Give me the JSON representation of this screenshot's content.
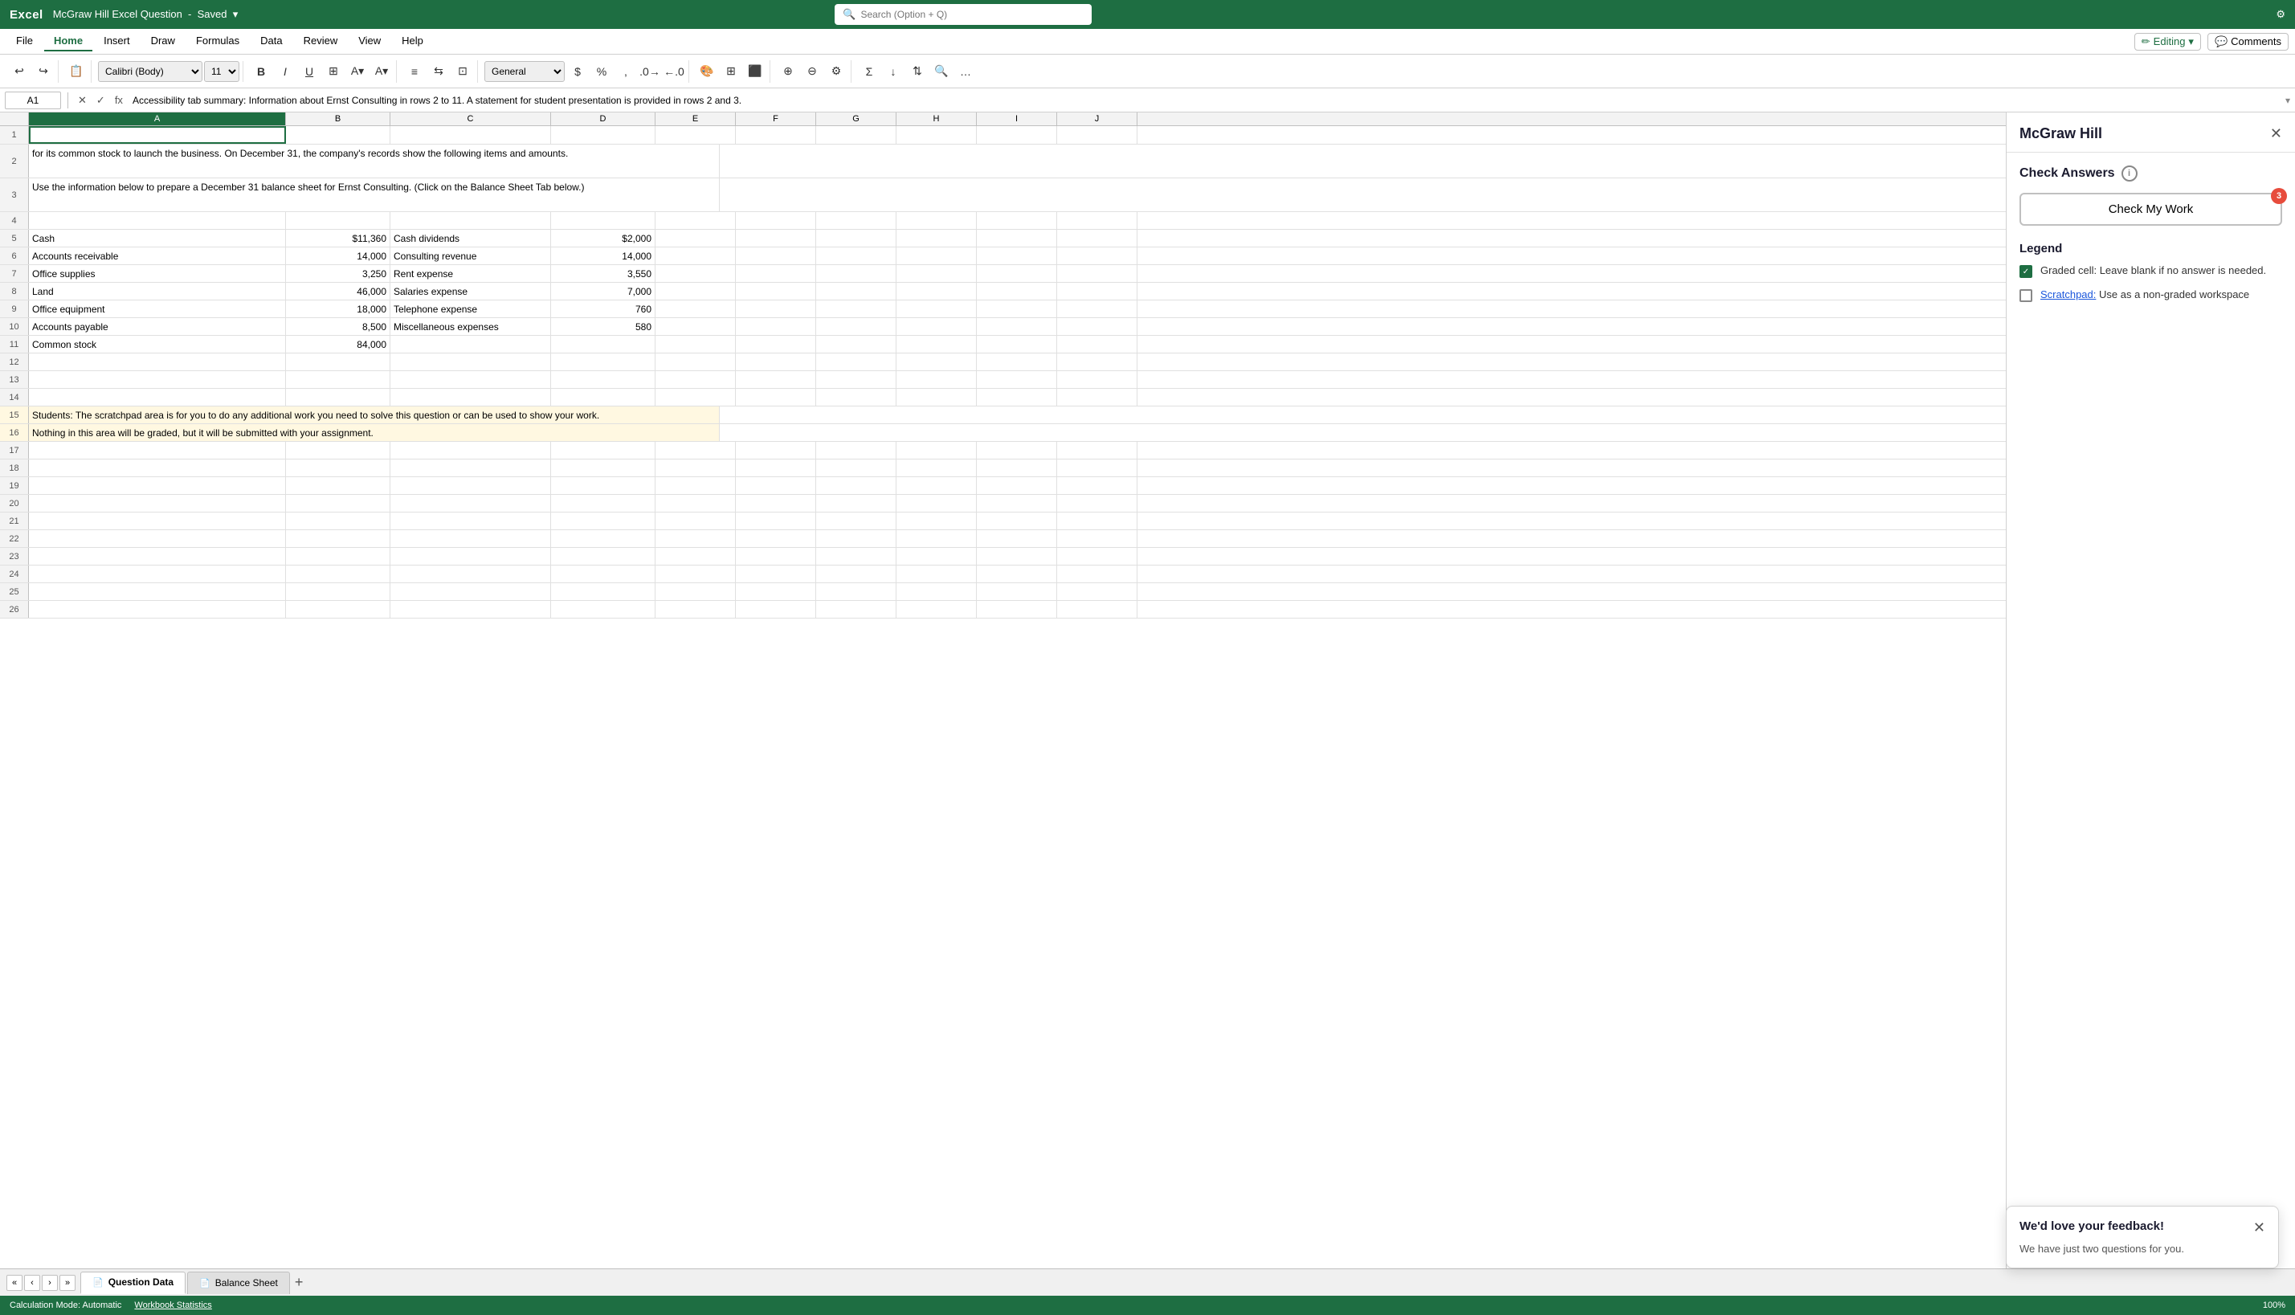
{
  "titleBar": {
    "appName": "Excel",
    "docName": "McGraw Hill Excel Question",
    "savedStatus": "Saved",
    "searchPlaceholder": "Search (Option + Q)",
    "settingsIcon": "⚙"
  },
  "ribbonTabs": {
    "tabs": [
      "File",
      "Home",
      "Insert",
      "Draw",
      "Formulas",
      "Data",
      "Review",
      "View",
      "Help"
    ],
    "activeTab": "Home",
    "editingLabel": "✏ Editing",
    "commentsLabel": "💬 Comments"
  },
  "toolbar": {
    "undoIcon": "↩",
    "redoIcon": "↪",
    "fontName": "Calibri (Body)",
    "fontSize": "11",
    "boldLabel": "B",
    "formatNumber": "General"
  },
  "formulaBar": {
    "cellRef": "A1",
    "formula": "Accessibility tab summary: Information about Ernst Consulting in rows 2 to 11. A statement for student presentation is provided in rows 2 and 3."
  },
  "columns": [
    "A",
    "B",
    "C",
    "D",
    "E",
    "F",
    "G",
    "H",
    "I",
    "J"
  ],
  "rows": [
    {
      "num": 1,
      "cells": [
        "",
        "",
        "",
        "",
        "",
        "",
        "",
        "",
        "",
        ""
      ]
    },
    {
      "num": 2,
      "cells": [
        "for its common stock to launch the business. On December 31, the company's records show the following items and amounts.",
        "",
        "",
        "",
        "",
        "",
        "",
        "",
        "",
        ""
      ],
      "merged": true
    },
    {
      "num": 3,
      "cells": [
        "Use the information below to prepare a December 31 balance sheet for Ernst Consulting. (Click on the Balance Sheet Tab below.)",
        "",
        "",
        "",
        "",
        "",
        "",
        "",
        "",
        ""
      ],
      "merged": true
    },
    {
      "num": 4,
      "cells": [
        "",
        "",
        "",
        "",
        "",
        "",
        "",
        "",
        "",
        ""
      ]
    },
    {
      "num": 5,
      "cells": [
        "Cash",
        "$11,360",
        "Cash dividends",
        "$2,000",
        "",
        "",
        "",
        "",
        "",
        ""
      ]
    },
    {
      "num": 6,
      "cells": [
        "Accounts receivable",
        "14,000",
        "Consulting revenue",
        "14,000",
        "",
        "",
        "",
        "",
        "",
        ""
      ]
    },
    {
      "num": 7,
      "cells": [
        "Office supplies",
        "3,250",
        "Rent expense",
        "3,550",
        "",
        "",
        "",
        "",
        "",
        ""
      ]
    },
    {
      "num": 8,
      "cells": [
        "Land",
        "46,000",
        "Salaries expense",
        "7,000",
        "",
        "",
        "",
        "",
        "",
        ""
      ]
    },
    {
      "num": 9,
      "cells": [
        "Office equipment",
        "18,000",
        "Telephone expense",
        "760",
        "",
        "",
        "",
        "",
        "",
        ""
      ]
    },
    {
      "num": 10,
      "cells": [
        "Accounts payable",
        "8,500",
        "Miscellaneous expenses",
        "580",
        "",
        "",
        "",
        "",
        "",
        ""
      ]
    },
    {
      "num": 11,
      "cells": [
        "Common stock",
        "84,000",
        "",
        "",
        "",
        "",
        "",
        "",
        "",
        ""
      ]
    },
    {
      "num": 12,
      "cells": [
        "",
        "",
        "",
        "",
        "",
        "",
        "",
        "",
        "",
        ""
      ]
    },
    {
      "num": 13,
      "cells": [
        "",
        "",
        "",
        "",
        "",
        "",
        "",
        "",
        "",
        ""
      ]
    },
    {
      "num": 14,
      "cells": [
        "",
        "",
        "",
        "",
        "",
        "",
        "",
        "",
        "",
        ""
      ]
    },
    {
      "num": 15,
      "cells": [
        "Students: The scratchpad area is for you to do any additional work you need to solve this question or can be used to show your work.",
        "",
        "",
        "",
        "",
        "",
        "",
        "",
        "",
        ""
      ],
      "scratchpad": true,
      "merged": true
    },
    {
      "num": 16,
      "cells": [
        "Nothing in this area will be graded, but it will be submitted with your assignment.",
        "",
        "",
        "",
        "",
        "",
        "",
        "",
        "",
        ""
      ],
      "scratchpad": true,
      "merged": true
    },
    {
      "num": 17,
      "cells": [
        "",
        "",
        "",
        "",
        "",
        "",
        "",
        "",
        "",
        ""
      ]
    },
    {
      "num": 18,
      "cells": [
        "",
        "",
        "",
        "",
        "",
        "",
        "",
        "",
        "",
        ""
      ]
    },
    {
      "num": 19,
      "cells": [
        "",
        "",
        "",
        "",
        "",
        "",
        "",
        "",
        "",
        ""
      ]
    },
    {
      "num": 20,
      "cells": [
        "",
        "",
        "",
        "",
        "",
        "",
        "",
        "",
        "",
        ""
      ]
    },
    {
      "num": 21,
      "cells": [
        "",
        "",
        "",
        "",
        "",
        "",
        "",
        "",
        "",
        ""
      ]
    },
    {
      "num": 22,
      "cells": [
        "",
        "",
        "",
        "",
        "",
        "",
        "",
        "",
        "",
        ""
      ]
    },
    {
      "num": 23,
      "cells": [
        "",
        "",
        "",
        "",
        "",
        "",
        "",
        "",
        "",
        ""
      ]
    },
    {
      "num": 24,
      "cells": [
        "",
        "",
        "",
        "",
        "",
        "",
        "",
        "",
        "",
        ""
      ]
    },
    {
      "num": 25,
      "cells": [
        "",
        "",
        "",
        "",
        "",
        "",
        "",
        "",
        "",
        ""
      ]
    },
    {
      "num": 26,
      "cells": [
        "",
        "",
        "",
        "",
        "",
        "",
        "",
        "",
        "",
        ""
      ]
    }
  ],
  "sheetTabs": {
    "navPrev": "‹",
    "navNext": "›",
    "navFirst": "«",
    "navLast": "»",
    "tabs": [
      {
        "label": "Question Data",
        "active": true,
        "icon": "📄"
      },
      {
        "label": "Balance Sheet",
        "active": false,
        "icon": "📄"
      }
    ],
    "addIcon": "+"
  },
  "statusBar": {
    "calcMode": "Calculation Mode: Automatic",
    "wbStats": "Workbook Statistics",
    "zoomPercent": "100%"
  },
  "mcgrawPanel": {
    "title": "McGraw Hill",
    "closeIcon": "✕",
    "checkAnswers": {
      "title": "Check Answers",
      "infoIcon": "i",
      "btnLabel": "Check My Work",
      "badge": "3"
    },
    "legend": {
      "title": "Legend",
      "items": [
        {
          "checked": true,
          "text": "Graded cell: Leave blank if no answer is needed."
        },
        {
          "checked": false,
          "linkText": "Scratchpad:",
          "text": " Use as a non-graded workspace"
        }
      ]
    }
  },
  "feedbackPopup": {
    "title": "We'd love your feedback!",
    "body": "We have just two questions for you.",
    "closeIcon": "✕"
  }
}
